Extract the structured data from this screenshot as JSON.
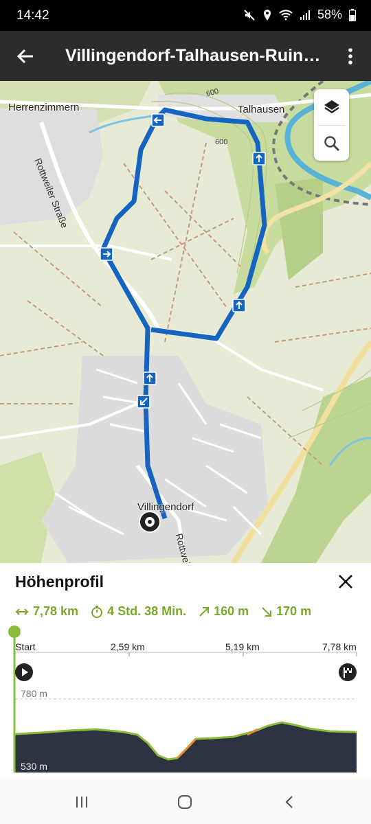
{
  "status": {
    "time": "14:42",
    "battery": "58%"
  },
  "appbar": {
    "title": "Villingendorf-Talhausen-Ruine..."
  },
  "map": {
    "places": {
      "herrenzimmern": "Herrenzimmern",
      "talhausen": "Talhausen",
      "villingendorf": "Villingendorf"
    },
    "road_labels": {
      "rottweiler_strasse": "Rottweiler Straße",
      "rottweil": "Rottweil",
      "contour_600_a": "600",
      "contour_600_b": "600"
    },
    "route_color": "#1565c0",
    "controls": [
      "layers-icon",
      "search-icon"
    ]
  },
  "elevation": {
    "title": "Höhenprofil",
    "stats": {
      "distance": "7,78 km",
      "duration": "4 Std. 38 Min.",
      "ascent": "160 m",
      "descent": "170 m"
    },
    "axis": {
      "start": "Start",
      "mark1": "2,59 km",
      "mark2": "5,19 km",
      "end": "7,78 km"
    },
    "elev_max": "780 m",
    "elev_min": "530 m",
    "accent_color": "#7aa82a"
  },
  "navbar": [
    "recent-apps",
    "home",
    "back"
  ]
}
